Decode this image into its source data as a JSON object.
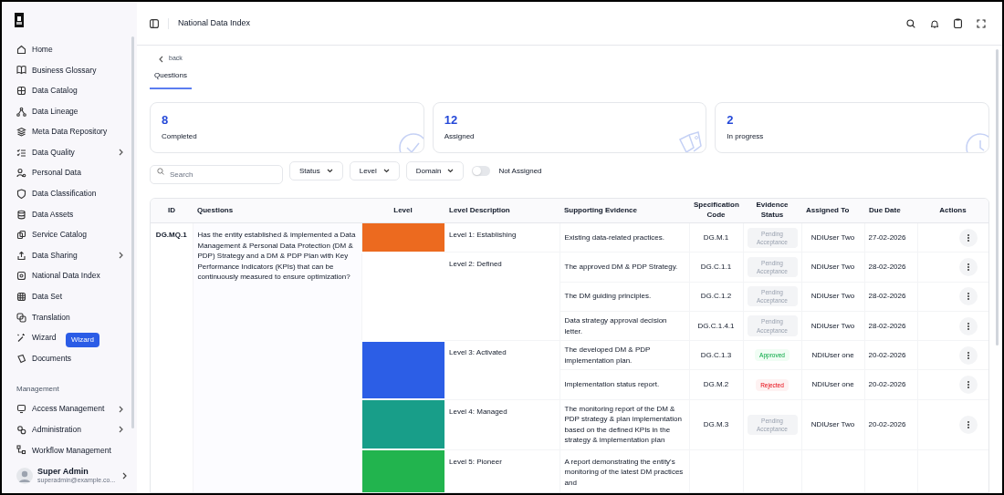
{
  "sidebar": {
    "items": [
      {
        "label": "Home",
        "expandable": false
      },
      {
        "label": "Business Glossary",
        "expandable": false
      },
      {
        "label": "Data Catalog",
        "expandable": false
      },
      {
        "label": "Data Lineage",
        "expandable": false
      },
      {
        "label": "Meta Data Repository",
        "expandable": false
      },
      {
        "label": "Data Quality",
        "expandable": true
      },
      {
        "label": "Personal Data",
        "expandable": false
      },
      {
        "label": "Data Classification",
        "expandable": false
      },
      {
        "label": "Data Assets",
        "expandable": false
      },
      {
        "label": "Service Catalog",
        "expandable": false
      },
      {
        "label": "Data Sharing",
        "expandable": true
      },
      {
        "label": "National Data Index",
        "expandable": false
      },
      {
        "label": "Data Set",
        "expandable": false
      },
      {
        "label": "Translation",
        "expandable": false
      },
      {
        "label": "Wizard",
        "expandable": false
      },
      {
        "label": "Documents",
        "expandable": false
      }
    ],
    "tooltip": "Wizard",
    "section_label": "Management",
    "management_items": [
      {
        "label": "Access Management",
        "expandable": true
      },
      {
        "label": "Administration",
        "expandable": true
      },
      {
        "label": "Workflow Management",
        "expandable": false
      }
    ],
    "user": {
      "name": "Super Admin",
      "email": "superadmin@example.co..."
    }
  },
  "header": {
    "title": "National Data Index"
  },
  "back_link": "back",
  "tabs": [
    {
      "label": "Questions",
      "selected": true
    }
  ],
  "stats": [
    {
      "value": "8",
      "label": "Completed"
    },
    {
      "value": "12",
      "label": "Assigned"
    },
    {
      "value": "2",
      "label": "In progress"
    }
  ],
  "filters": {
    "search": {
      "placeholder": "Search"
    },
    "dropdowns": [
      "Status",
      "Level",
      "Domain"
    ],
    "toggle": {
      "label": "Not Assigned",
      "on": false
    }
  },
  "table": {
    "columns": [
      "ID",
      "Questions",
      "Level",
      "Level Description",
      "Supporting Evidence",
      "Specification Code",
      "Evidence Status",
      "Assigned To",
      "Due Date",
      "Actions"
    ],
    "rows": [
      {
        "id": "DG.MQ.1",
        "question": "Has the entity established & implemented a Data Management & Personal Data Protection (DM & PDP) Strategy and a DM & PDP Plan with Key Performance Indicators (KPIs) that can be continuously measured to ensure optimization?",
        "levels": [
          {
            "name": "Level 1: Establishing",
            "color": "#ec6a1f",
            "evidence": [
              {
                "text": "Existing data-related practices.",
                "code": "DG.M.1",
                "status": {
                  "kind": "pending",
                  "label": "Pending Acceptance"
                },
                "assigned": "NDIUser Two",
                "due": "27-02-2026"
              }
            ]
          },
          {
            "name": "Level 2: Defined",
            "color": "#ffffff",
            "evidence": [
              {
                "text": "The approved DM & PDP Strategy.",
                "code": "DG.C.1.1",
                "status": {
                  "kind": "pending",
                  "label": "Pending Acceptance"
                },
                "assigned": "NDIUser Two",
                "due": "28-02-2026"
              },
              {
                "text": "The DM guiding principles.",
                "code": "DG.C.1.2",
                "status": {
                  "kind": "pending",
                  "label": "Pending Acceptance"
                },
                "assigned": "NDIUser Two",
                "due": "28-02-2026"
              },
              {
                "text": "Data strategy approval decision letter.",
                "code": "DG.C.1.4.1",
                "status": {
                  "kind": "pending",
                  "label": "Pending Acceptance"
                },
                "assigned": "NDIUser Two",
                "due": "28-02-2026"
              }
            ]
          },
          {
            "name": "Level 3: Activated",
            "color": "#2c5ee6",
            "evidence": [
              {
                "text": "The developed DM & PDP implementation plan.",
                "code": "DG.C.1.3",
                "status": {
                  "kind": "approved",
                  "label": "Approved"
                },
                "assigned": "NDIUser one",
                "due": "20-02-2026"
              },
              {
                "text": "Implementation status report.",
                "code": "DG.M.2",
                "status": {
                  "kind": "rejected",
                  "label": "Rejected"
                },
                "assigned": "NDIUser one",
                "due": "20-02-2026"
              }
            ]
          },
          {
            "name": "Level 4: Managed",
            "color": "#189e89",
            "evidence": [
              {
                "text": "The monitoring report of the DM & PDP strategy & plan implementation based on the defined KPIs in the strategy & implementation plan",
                "code": "DG.M.3",
                "status": {
                  "kind": "pending",
                  "label": "Pending Acceptance"
                },
                "assigned": "NDIUser Two",
                "due": "20-02-2026"
              }
            ]
          },
          {
            "name": "Level 5: Pioneer",
            "color": "#22b44e",
            "evidence": [
              {
                "text": "A report demonstrating the entity's monitoring of the latest DM practices and"
              }
            ]
          }
        ]
      }
    ]
  }
}
